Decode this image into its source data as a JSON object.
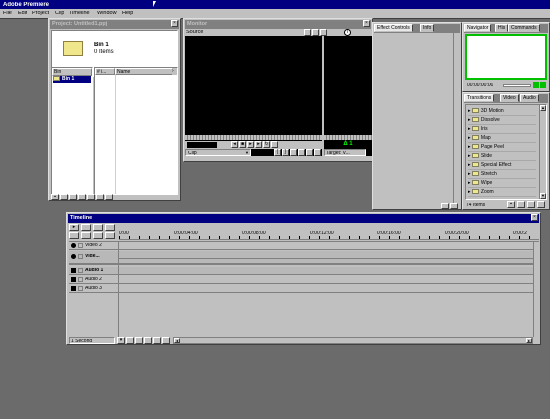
{
  "app": {
    "title": "Adobe Premiere",
    "menu": [
      "File",
      "Edit",
      "Project",
      "Clip",
      "Timeline",
      "Window",
      "Help"
    ]
  },
  "project": {
    "title": "Project: Untitled1.ppj",
    "bin_name": "Bin 1",
    "bin_count": "0 Items",
    "bins_col": "Bin",
    "col_num": "# i...",
    "col_name": "Name",
    "bin_row": "Bin 1"
  },
  "monitor": {
    "title": "Monitor",
    "source_label": "Source",
    "clip_label": "Clip",
    "target_label": "Target: V...",
    "program_marker": "Δ 1"
  },
  "effect_controls": {
    "tabs": [
      "Effect Controls",
      "Info"
    ]
  },
  "navigator": {
    "tabs": [
      "Navigator",
      "His",
      "Commands"
    ],
    "timecode": "00:00:00:00"
  },
  "transitions": {
    "tabs": [
      "Transitions",
      "Video",
      "Audio"
    ],
    "items": [
      "3D Motion",
      "Dissolve",
      "Iris",
      "Map",
      "Page Peel",
      "Slide",
      "Special Effect",
      "Stretch",
      "Wipe",
      "Zoom"
    ],
    "count": "74 Items"
  },
  "timeline": {
    "title": "Timeline",
    "ruler": [
      "0:00",
      "0:00:04:00",
      "0:00:08:00",
      "0:00:12:00",
      "0:00:16:00",
      "0:00:20:00",
      "0:00:2"
    ],
    "tracks": [
      "Video 2",
      "Vide...",
      "Audio 1",
      "Audio 2",
      "Audio 3"
    ],
    "zoom": "1 Second"
  }
}
